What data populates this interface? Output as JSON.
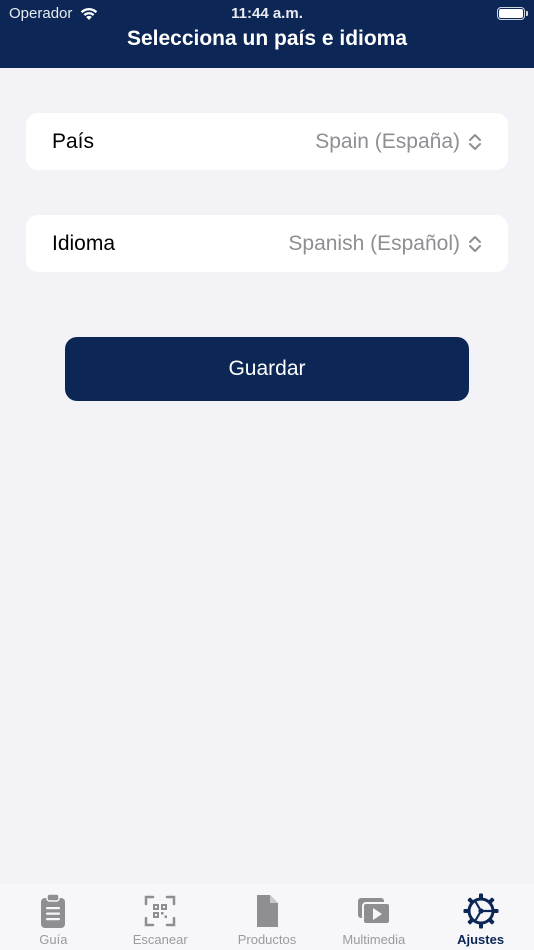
{
  "status_bar": {
    "carrier": "Operador",
    "time": "11:44 a.m."
  },
  "header": {
    "title": "Selecciona un país e idioma"
  },
  "country_row": {
    "label": "País",
    "value": "Spain (España)"
  },
  "language_row": {
    "label": "Idioma",
    "value": "Spanish (Español)"
  },
  "save_button": {
    "label": "Guardar"
  },
  "tab_bar": {
    "active": "Ajustes",
    "tabs": [
      {
        "label": "Guía",
        "icon": "clipboard-icon"
      },
      {
        "label": "Escanear",
        "icon": "qr-scan-icon"
      },
      {
        "label": "Productos",
        "icon": "document-icon"
      },
      {
        "label": "Multimedia",
        "icon": "video-library-icon"
      },
      {
        "label": "Ajustes",
        "icon": "gear-icon"
      }
    ]
  },
  "colors": {
    "brand_navy": "#0c2655",
    "background": "#f2f2f7",
    "inactive_tab": "#9a9a9f",
    "value_gray": "#8e8e93"
  }
}
